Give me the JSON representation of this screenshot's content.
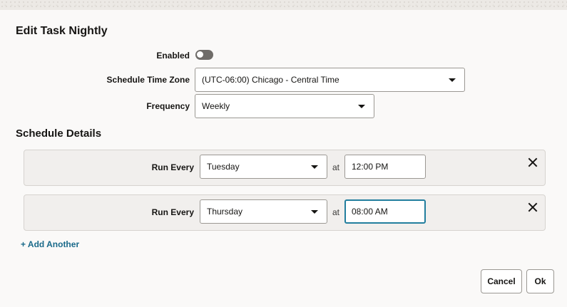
{
  "dialog": {
    "title": "Edit Task Nightly"
  },
  "enabled": {
    "label": "Enabled",
    "value": false
  },
  "timezone": {
    "label": "Schedule Time Zone",
    "value": "(UTC-06:00) Chicago - Central Time"
  },
  "frequency": {
    "label": "Frequency",
    "value": "Weekly"
  },
  "schedule": {
    "title": "Schedule Details",
    "rows": [
      {
        "label": "Run Every",
        "day": "Tuesday",
        "at": "at",
        "time": "12:00 PM"
      },
      {
        "label": "Run Every",
        "day": "Thursday",
        "at": "at",
        "time": "08:00 AM"
      }
    ],
    "add_label": "+ Add Another"
  },
  "footer": {
    "cancel_label": "Cancel",
    "ok_label": "Ok"
  },
  "colors": {
    "accent": "#227e9e",
    "link": "#1a6a8a"
  }
}
